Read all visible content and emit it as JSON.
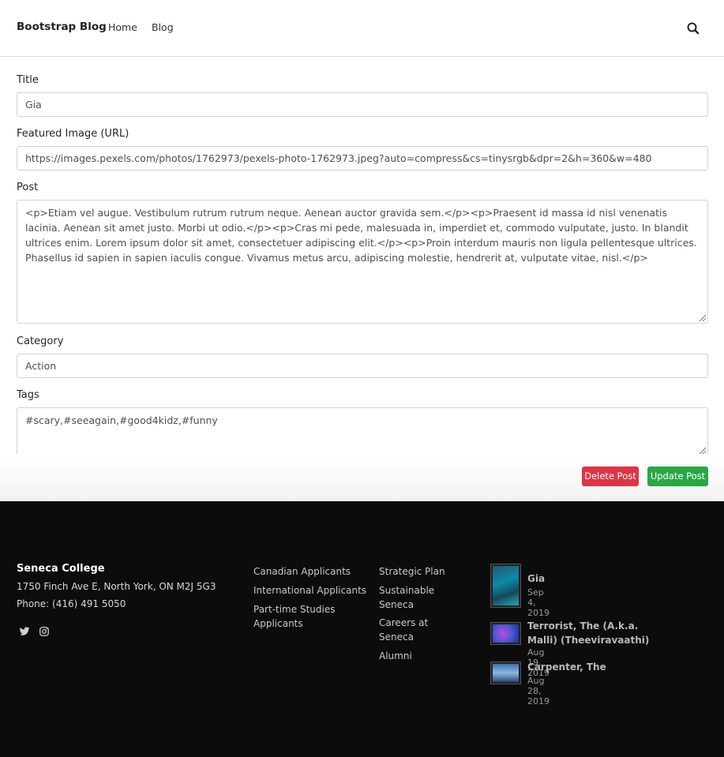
{
  "navbar": {
    "brand": "Bootstrap Blog",
    "links": [
      "Home",
      "Blog"
    ],
    "search_icon": "search-icon"
  },
  "form": {
    "title_label": "Title",
    "title_value": "Gia",
    "image_label": "Featured Image (URL)",
    "image_value": "https://images.pexels.com/photos/1762973/pexels-photo-1762973.jpeg?auto=compress&cs=tinysrgb&dpr=2&h=360&w=480",
    "post_label": "Post",
    "post_value": "<p>Etiam vel augue. Vestibulum rutrum rutrum neque. Aenean auctor gravida sem.</p><p>Praesent id massa id nisl venenatis lacinia. Aenean sit amet justo. Morbi ut odio.</p><p>Cras mi pede, malesuada in, imperdiet et, commodo vulputate, justo. In blandit ultrices enim. Lorem ipsum dolor sit amet, consectetuer adipiscing elit.</p><p>Proin interdum mauris non ligula pellentesque ultrices. Phasellus id sapien in sapien iaculis congue. Vivamus metus arcu, adipiscing molestie, hendrerit at, vulputate vitae, nisl.</p>",
    "category_label": "Category",
    "category_value": "Action",
    "tags_label": "Tags",
    "tags_value": "#scary,#seeagain,#good4kidz,#funny",
    "delete_label": "Delete Post",
    "update_label": "Update Post"
  },
  "footer": {
    "org": "Seneca College",
    "address": "1750 Finch Ave E, North York, ON M2J 5G3",
    "phone": "Phone: (416) 491 5050",
    "social_icons": [
      "twitter-icon",
      "instagram-icon"
    ],
    "links_col1": [
      "Canadian Applicants",
      "International Applicants",
      "Part-time Studies Applicants"
    ],
    "links_col2": [
      "Strategic Plan",
      "Sustainable Seneca",
      "Careers at Seneca",
      "Alumni"
    ],
    "recent_posts": [
      {
        "title": "Gia",
        "date": "Sep 4, 2019"
      },
      {
        "title": "Terrorist, The (A.k.a. Malli) (Theeviravaathi)",
        "date": "Aug 19, 2019"
      },
      {
        "title": "Carpenter, The",
        "date": "Aug 28, 2019"
      }
    ]
  },
  "colors": {
    "danger": "#dc3545",
    "success": "#28a745",
    "footer_bg": "#0c0c0d"
  }
}
